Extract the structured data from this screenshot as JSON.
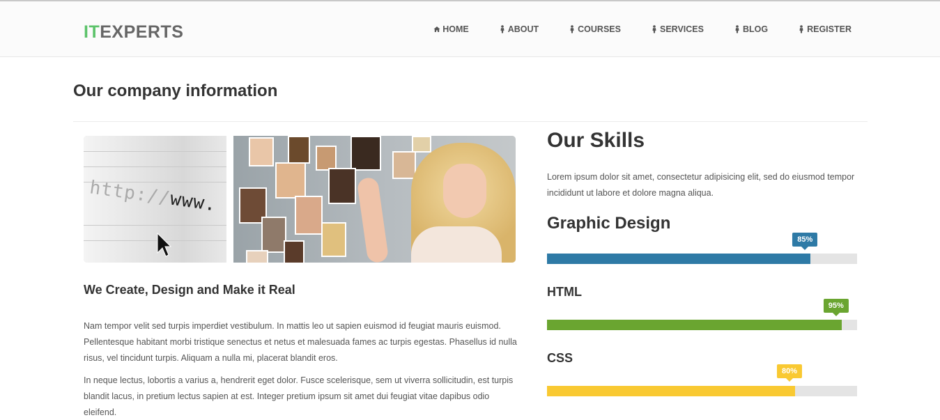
{
  "brand": {
    "logo_prefix": "IT",
    "logo_rest": "EXPERTS"
  },
  "nav": [
    {
      "label": "HOME",
      "icon": "home-icon"
    },
    {
      "label": "ABOUT",
      "icon": "person-icon"
    },
    {
      "label": "COURSES",
      "icon": "person-icon"
    },
    {
      "label": "SERVICES",
      "icon": "person-icon"
    },
    {
      "label": "BLOG",
      "icon": "person-icon"
    },
    {
      "label": "REGISTER",
      "icon": "person-icon"
    }
  ],
  "page": {
    "title": "Our company information"
  },
  "hero": {
    "url_text_dim": "http://",
    "url_text": "www."
  },
  "about": {
    "heading": "We Create, Design and Make it Real",
    "paragraph_1": "Nam tempor velit sed turpis imperdiet vestibulum. In mattis leo ut sapien euismod id feugiat mauris euismod. Pellentesque habitant morbi tristique senectus et netus et malesuada fames ac turpis egestas. Phasellus id nulla risus, vel tincidunt turpis. Aliquam a nulla mi, placerat blandit eros.",
    "paragraph_2": "In neque lectus, lobortis a varius a, hendrerit eget dolor. Fusce scelerisque, sem ut viverra sollicitudin, est turpis blandit lacus, in pretium lectus sapien at est. Integer pretium ipsum sit amet dui feugiat vitae dapibus odio eleifend."
  },
  "skills": {
    "title": "Our Skills",
    "intro": "Lorem ipsum dolor sit amet, consectetur adipisicing elit, sed do eiusmod tempor incididunt ut labore et dolore magna aliqua.",
    "items": [
      {
        "name": "Graphic Design",
        "percent": 85,
        "label": "85%",
        "color": "#2e7aa6"
      },
      {
        "name": "HTML",
        "percent": 95,
        "label": "95%",
        "color": "#6aa530"
      },
      {
        "name": "CSS",
        "percent": 80,
        "label": "80%",
        "color": "#f9c932"
      }
    ]
  },
  "colors": {
    "accent_green": "#5cc36a",
    "text_dark": "#333333",
    "text_body": "#555555",
    "track": "#e4e4e4"
  }
}
